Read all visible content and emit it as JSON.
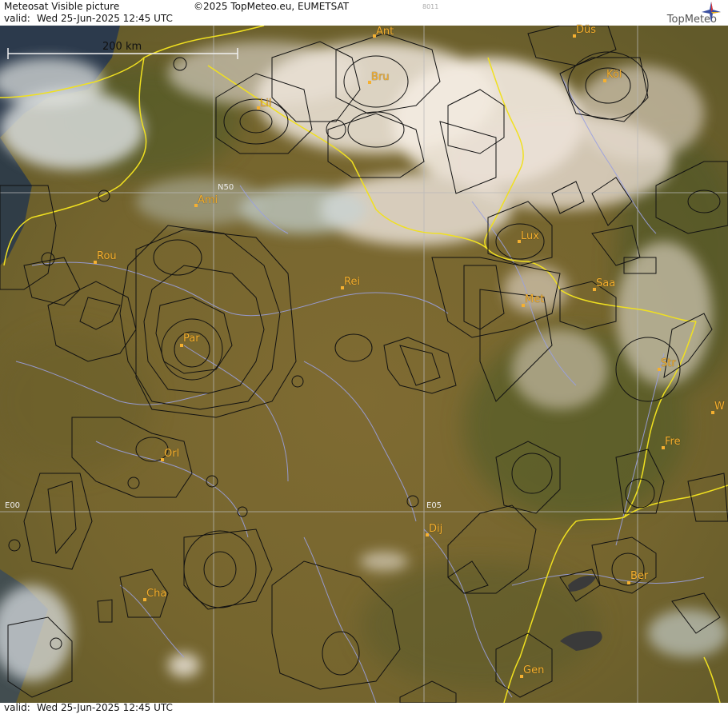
{
  "header": {
    "title": "Meteosat Visible picture",
    "copyright": "©2025 TopMeteo.eu, EUMETSAT",
    "code": "8011",
    "valid_label": "valid:",
    "valid_time": "Wed  25-Jun-2025  12:45 UTC",
    "logo_text": "TopMeteo"
  },
  "footer": {
    "valid_label": "valid:",
    "valid_time": "Wed  25-Jun-2025  12:45 UTC"
  },
  "scale": {
    "label": "200 km"
  },
  "grid_labels": {
    "n50": "N50",
    "e00": "E00",
    "e05": "E05"
  },
  "cities": [
    {
      "id": "ant",
      "label": "Ant"
    },
    {
      "id": "dus",
      "label": "Düs"
    },
    {
      "id": "bru",
      "label": "Bru"
    },
    {
      "id": "kol",
      "label": "Köl"
    },
    {
      "id": "lil",
      "label": "Lil"
    },
    {
      "id": "ami",
      "label": "Ami"
    },
    {
      "id": "rou",
      "label": "Rou"
    },
    {
      "id": "lux",
      "label": "Lux"
    },
    {
      "id": "rei",
      "label": "Rei"
    },
    {
      "id": "saa",
      "label": "Saa"
    },
    {
      "id": "met",
      "label": "Met"
    },
    {
      "id": "par",
      "label": "Par"
    },
    {
      "id": "str",
      "label": "Str"
    },
    {
      "id": "w",
      "label": "W"
    },
    {
      "id": "fre",
      "label": "Fre"
    },
    {
      "id": "orl",
      "label": "Orl"
    },
    {
      "id": "dij",
      "label": "Dij"
    },
    {
      "id": "ber",
      "label": "Ber"
    },
    {
      "id": "cha",
      "label": "Cha"
    },
    {
      "id": "gen",
      "label": "Gen"
    }
  ],
  "colors": {
    "land": "#7d6a30",
    "cloud": "#ece4dc",
    "border": "#f0e020",
    "river": "#9aa0e0",
    "airspace": "#111111",
    "grid": "#b8b8b8",
    "city": "#f5b030"
  }
}
